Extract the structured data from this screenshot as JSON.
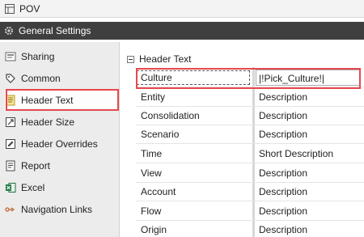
{
  "window": {
    "title": "POV"
  },
  "section": {
    "title": "General Settings"
  },
  "sidebar": {
    "items": [
      {
        "label": "Sharing",
        "icon": "sharing-icon"
      },
      {
        "label": "Common",
        "icon": "tag-icon"
      },
      {
        "label": "Header Text",
        "icon": "document-icon",
        "selected": true
      },
      {
        "label": "Header Size",
        "icon": "resize-icon"
      },
      {
        "label": "Header Overrides",
        "icon": "edit-icon"
      },
      {
        "label": "Report",
        "icon": "report-icon"
      },
      {
        "label": "Excel",
        "icon": "excel-icon"
      },
      {
        "label": "Navigation Links",
        "icon": "link-icon"
      }
    ]
  },
  "grid": {
    "group_label": "Header Text",
    "rows": [
      {
        "name": "Culture",
        "value": "|!Pick_Culture!|"
      },
      {
        "name": "Entity",
        "value": "Description"
      },
      {
        "name": "Consolidation",
        "value": "Description"
      },
      {
        "name": "Scenario",
        "value": "Description"
      },
      {
        "name": "Time",
        "value": "Short Description"
      },
      {
        "name": "View",
        "value": "Description"
      },
      {
        "name": "Account",
        "value": "Description"
      },
      {
        "name": "Flow",
        "value": "Description"
      },
      {
        "name": "Origin",
        "value": "Description"
      }
    ]
  },
  "colors": {
    "highlight": "#e8474f",
    "section_bar": "#3f3f3f"
  }
}
